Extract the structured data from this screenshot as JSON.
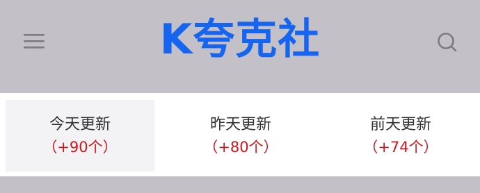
{
  "header": {
    "logo_text": "K夸克社",
    "brand_color": "#1565f0",
    "menu_icon": "hamburger-menu-icon",
    "search_icon": "search-icon"
  },
  "tabs": [
    {
      "title": "今天更新",
      "count": "（+90个）",
      "active": true
    },
    {
      "title": "昨天更新",
      "count": "（+80个）",
      "active": false
    },
    {
      "title": "前天更新",
      "count": "（+74个）",
      "active": false
    }
  ],
  "colors": {
    "header_bg": "#c4c0c8",
    "count_red": "#d3141a",
    "active_tab_bg": "#f3f3f5"
  }
}
